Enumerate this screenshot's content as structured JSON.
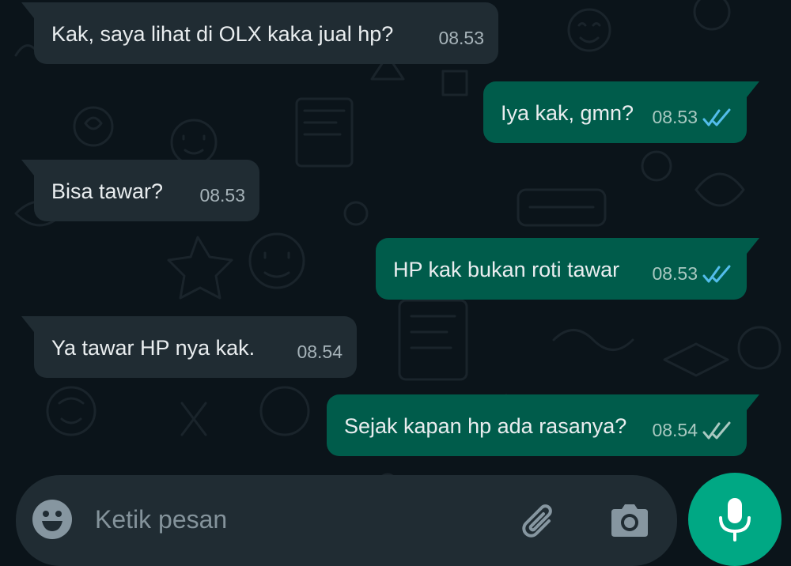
{
  "messages": [
    {
      "direction": "incoming",
      "text": "Kak, saya lihat di OLX kaka jual hp?",
      "time": "08.53",
      "read": null
    },
    {
      "direction": "outgoing",
      "text": "Iya kak, gmn?",
      "time": "08.53",
      "read": true
    },
    {
      "direction": "incoming",
      "text": "Bisa tawar?",
      "time": "08.53",
      "read": null
    },
    {
      "direction": "outgoing",
      "text": "HP kak bukan roti tawar",
      "time": "08.53",
      "read": true
    },
    {
      "direction": "incoming",
      "text": "Ya tawar HP nya kak.",
      "time": "08.54",
      "read": null
    },
    {
      "direction": "outgoing",
      "text": "Sejak kapan hp ada rasanya?",
      "time": "08.54",
      "read": false
    }
  ],
  "composer": {
    "placeholder": "Ketik pesan",
    "emoji_icon": "emoji-icon",
    "attach_icon": "paperclip-icon",
    "camera_icon": "camera-icon",
    "send_icon": "microphone-icon"
  },
  "colors": {
    "background": "#0b141a",
    "incoming_bubble": "#202c33",
    "outgoing_bubble": "#005c4b",
    "read_ticks": "#53bdeb",
    "delivered_ticks": "#a9c9c1",
    "accent": "#00a884"
  }
}
